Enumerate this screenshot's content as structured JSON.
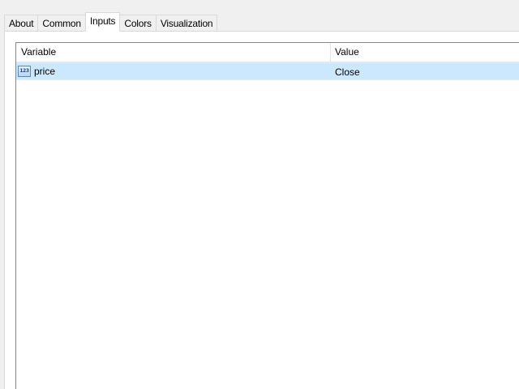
{
  "tabs": [
    {
      "label": "About"
    },
    {
      "label": "Common"
    },
    {
      "label": "Inputs",
      "active": true
    },
    {
      "label": "Colors"
    },
    {
      "label": "Visualization"
    }
  ],
  "inputs_table": {
    "columns": {
      "variable": "Variable",
      "value": "Value"
    },
    "rows": [
      {
        "icon": "integer-type-icon",
        "icon_text": "123",
        "variable": "price",
        "value": "Close",
        "selected": true
      }
    ]
  },
  "colors": {
    "selection_bg": "#cce8ff",
    "window_bg": "#f0f0f0",
    "panel_bg": "#ffffff"
  }
}
